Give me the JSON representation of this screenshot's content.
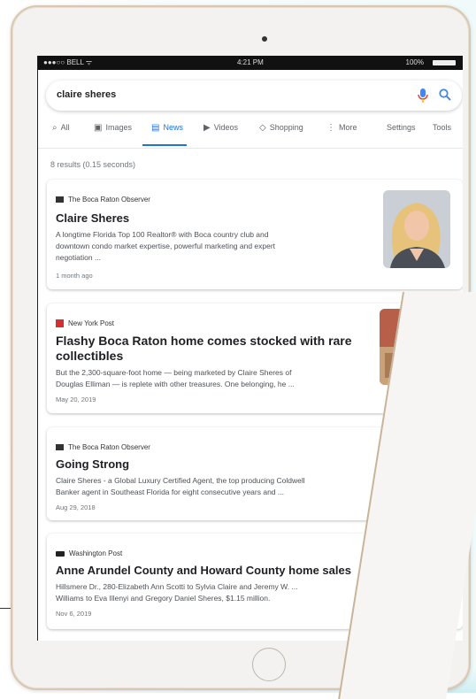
{
  "status_bar": {
    "carrier": "●●●○○ BELL ᯤ",
    "time": "4:21 PM",
    "battery": "100%"
  },
  "search": {
    "query": "claire sheres"
  },
  "tabs": [
    {
      "label": "All",
      "icon": "search-icon"
    },
    {
      "label": "Images",
      "icon": "image-icon"
    },
    {
      "label": "News",
      "icon": "news-icon",
      "active": true
    },
    {
      "label": "Videos",
      "icon": "video-icon"
    },
    {
      "label": "Shopping",
      "icon": "tag-icon"
    },
    {
      "label": "More",
      "icon": "more-icon"
    },
    {
      "label": "Settings"
    },
    {
      "label": "Tools"
    }
  ],
  "result_stats": "8 results (0.15 seconds)",
  "results": [
    {
      "source": "The Boca Raton Observer",
      "title": "Claire Sheres",
      "snippet": [
        "A longtime Florida Top 100 Realtor® with Boca country club and",
        "downtown condo market expertise, powerful marketing and expert",
        "negotiation ..."
      ],
      "date": "1 month ago"
    },
    {
      "source": "New York Post",
      "title": [
        "Flashy Boca Raton home comes stocked with rare",
        "collectibles"
      ],
      "snippet": [
        "But the 2,300-square-foot home — being marketed by Claire Sheres of",
        "Douglas Elliman — is replete with other treasures. One belonging, he ..."
      ],
      "date": "May 20, 2019"
    },
    {
      "source": "The Boca Raton Observer",
      "title": "Going Strong",
      "snippet": [
        "Claire Sheres - a Global Luxury Certified Agent, the top producing Coldwell",
        "Banker agent in Southeast Florida for eight consecutive years and ..."
      ],
      "date": "Aug 29, 2018"
    },
    {
      "source": "Washington Post",
      "title": "Anne Arundel County and Howard County home sales",
      "snippet": [
        "Hillsmere Dr., 280-Elizabeth Ann Scotti to Sylvia Claire and Jeremy W. ...",
        "Williams to Eva Illenyi and Gregory Daniel Sheres, $1.15 million."
      ],
      "date": "Nov 6, 2019"
    }
  ],
  "colors": {
    "accent": "#1a73e8",
    "ipad_frame": "#d9c7b2",
    "status_bar": "#111111"
  }
}
